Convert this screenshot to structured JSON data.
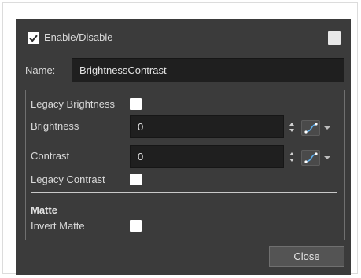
{
  "dialog": {
    "enable_label": "Enable/Disable",
    "enable_checked": true,
    "name_label": "Name:",
    "name_value": "BrightnessContrast",
    "legacy_brightness_label": "Legacy Brightness",
    "brightness_label": "Brightness",
    "brightness_value": "0",
    "contrast_label": "Contrast",
    "contrast_value": "0",
    "legacy_contrast_label": "Legacy Contrast",
    "matte_heading": "Matte",
    "invert_matte_label": "Invert Matte",
    "close_label": "Close"
  },
  "icons": {
    "checkmark": "checkmark-icon",
    "spinner": "up-down-arrows-icon",
    "function": "function-curve-icon",
    "dropdown": "chevron-down-icon"
  },
  "colors": {
    "panel_bg": "#3b3b3b",
    "field_bg": "#1f1f1f",
    "function_accent": "#5fb0f0"
  }
}
